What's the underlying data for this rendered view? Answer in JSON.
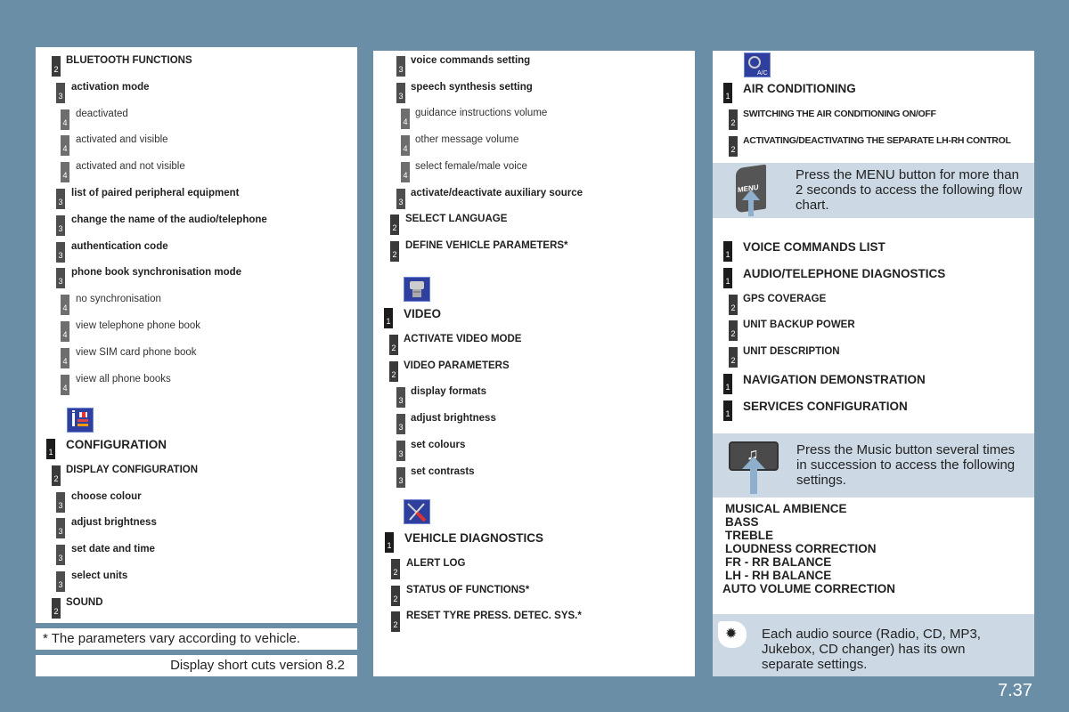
{
  "colors": {
    "background": "#6a8ea6",
    "info_box": "#ccd9e4",
    "level1": "#1c1c1c",
    "level2": "#3a3a3a",
    "level3": "#4e4e4e",
    "level4": "#6e6e6e"
  },
  "col1": {
    "items": [
      {
        "level": "2",
        "text": "BLUETOOTH FUNCTIONS"
      },
      {
        "level": "3",
        "text": "activation mode"
      },
      {
        "level": "4",
        "text": "deactivated"
      },
      {
        "level": "4",
        "text": "activated and visible"
      },
      {
        "level": "4",
        "text": "activated and not visible"
      },
      {
        "level": "3",
        "text": "list of paired peripheral equipment"
      },
      {
        "level": "3",
        "text": "change the name of the audio/telephone"
      },
      {
        "level": "3",
        "text": "authentication code"
      },
      {
        "level": "3",
        "text": "phone book synchronisation mode"
      },
      {
        "level": "4",
        "text": "no synchronisation"
      },
      {
        "level": "4",
        "text": "view telephone phone book"
      },
      {
        "level": "4",
        "text": "view SIM card phone book"
      },
      {
        "level": "4",
        "text": "view all phone books"
      }
    ],
    "config_icon": "configuration-icon",
    "config_items": [
      {
        "level": "1",
        "text": "CONFIGURATION"
      },
      {
        "level": "2",
        "text": "DISPLAY CONFIGURATION"
      },
      {
        "level": "3",
        "text": "choose colour"
      },
      {
        "level": "3",
        "text": "adjust brightness"
      },
      {
        "level": "3",
        "text": "set date and time"
      },
      {
        "level": "3",
        "text": "select units"
      },
      {
        "level": "2",
        "text": "SOUND"
      }
    ]
  },
  "col2": {
    "items": [
      {
        "level": "3",
        "text": "voice commands setting"
      },
      {
        "level": "3",
        "text": "speech synthesis setting"
      },
      {
        "level": "4",
        "text": "guidance instructions volume"
      },
      {
        "level": "4",
        "text": "other message volume"
      },
      {
        "level": "4",
        "text": "select female/male voice"
      },
      {
        "level": "3",
        "text": "activate/deactivate auxiliary source"
      },
      {
        "level": "2",
        "text": "SELECT LANGUAGE"
      },
      {
        "level": "2",
        "text": "DEFINE VEHICLE PARAMETERS*"
      }
    ],
    "video_items": [
      {
        "level": "1",
        "text": "VIDEO"
      },
      {
        "level": "2",
        "text": "ACTIVATE VIDEO MODE"
      },
      {
        "level": "2",
        "text": "VIDEO PARAMETERS"
      },
      {
        "level": "3",
        "text": "display formats"
      },
      {
        "level": "3",
        "text": "adjust brightness"
      },
      {
        "level": "3",
        "text": "set colours"
      },
      {
        "level": "3",
        "text": "set contrasts"
      }
    ],
    "diag_items": [
      {
        "level": "1",
        "text": "VEHICLE DIAGNOSTICS"
      },
      {
        "level": "2",
        "text": "ALERT LOG"
      },
      {
        "level": "2",
        "text": "STATUS OF FUNCTIONS*"
      },
      {
        "level": "2",
        "text": "RESET TYRE PRESS. DETEC. SYS.*"
      }
    ]
  },
  "col3": {
    "ac_items": [
      {
        "level": "1",
        "text": "AIR CONDITIONING"
      },
      {
        "level": "2",
        "text": "SWITCHING THE AIR CONDITIONING ON/OFF"
      },
      {
        "level": "2",
        "text": "ACTIVATING/DEACTIVATING THE SEPARATE LH-RH CONTROL"
      }
    ],
    "ac_icon_label": "A/C",
    "menu_info": {
      "button_label": "MENU",
      "text": "Press the MENU button for more than 2 seconds to access the following flow chart."
    },
    "menu_items": [
      {
        "level": "1",
        "text": "VOICE COMMANDS LIST"
      },
      {
        "level": "1",
        "text": "AUDIO/TELEPHONE DIAGNOSTICS"
      },
      {
        "level": "2",
        "text": "GPS COVERAGE"
      },
      {
        "level": "2",
        "text": "UNIT BACKUP POWER"
      },
      {
        "level": "2",
        "text": "UNIT DESCRIPTION"
      },
      {
        "level": "1",
        "text": "NAVIGATION DEMONSTRATION"
      },
      {
        "level": "1",
        "text": "SERVICES CONFIGURATION"
      }
    ],
    "music_info": {
      "text": "Press the Music button several times in succession to access the following settings."
    },
    "music_settings": [
      "MUSICAL AMBIENCE",
      "BASS",
      "TREBLE",
      "LOUDNESS CORRECTION",
      "FR - RR BALANCE",
      "LH - RH BALANCE",
      "AUTO VOLUME CORRECTION"
    ],
    "tip": {
      "text": "Each audio source (Radio, CD, MP3, Jukebox, CD changer) has its own separate settings."
    }
  },
  "footnote": "* The parameters vary according to vehicle.",
  "version": "Display short cuts version 8.2",
  "page_number": "7.37"
}
